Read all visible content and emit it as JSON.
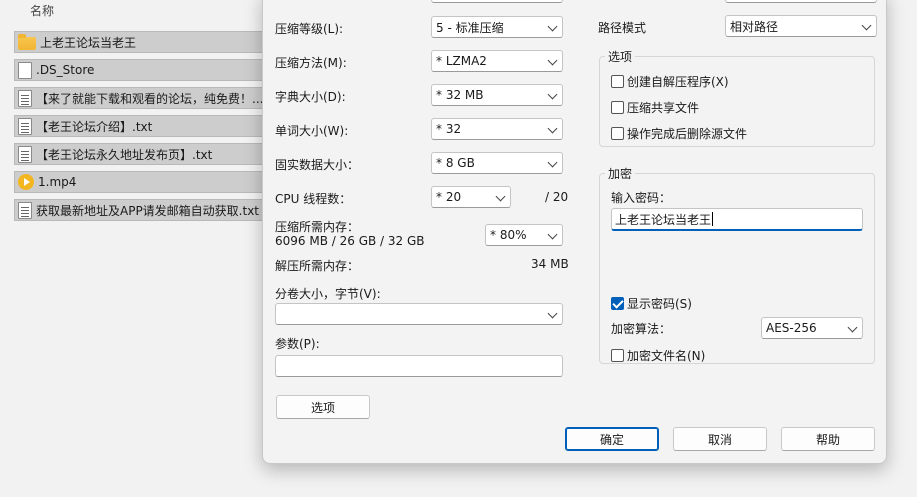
{
  "file_list": {
    "header": "名称",
    "items": [
      {
        "name": "上老王论坛当老王",
        "icon": "folder-icon"
      },
      {
        "name": ".DS_Store",
        "icon": "file-icon"
      },
      {
        "name": "【来了就能下载和观看的论坛，纯免费！...",
        "icon": "text-file-icon"
      },
      {
        "name": "【老王论坛介绍】.txt",
        "icon": "text-file-icon"
      },
      {
        "name": "【老王论坛永久地址发布页】.txt",
        "icon": "text-file-icon"
      },
      {
        "name": "1.mp4",
        "icon": "video-file-icon"
      },
      {
        "name": "获取最新地址及APP请发邮箱自动获取.txt",
        "icon": "text-file-icon"
      }
    ]
  },
  "dialog": {
    "compression_level": {
      "label": "压缩等级(L):",
      "value": "5 - 标准压缩"
    },
    "compression_method": {
      "label": "压缩方法(M):",
      "value": "* LZMA2"
    },
    "dictionary_size": {
      "label": "字典大小(D):",
      "value": "* 32 MB"
    },
    "word_size": {
      "label": "单词大小(W):",
      "value": "* 32"
    },
    "solid_block_size": {
      "label": "固实数据大小：",
      "value": "* 8 GB"
    },
    "cpu_threads": {
      "label": "CPU 线程数：",
      "value": "* 20",
      "max": "/ 20"
    },
    "compress_memory": {
      "label": "压缩所需内存：",
      "detail": "6096 MB / 26 GB / 32 GB",
      "value": "* 80%"
    },
    "decompress_memory": {
      "label": "解压所需内存：",
      "value": "34 MB"
    },
    "split_volumes": {
      "label": "分卷大小，字节(V):",
      "value": ""
    },
    "parameters": {
      "label": "参数(P):",
      "value": ""
    },
    "options_button": "选项",
    "path_mode": {
      "label": "路径模式",
      "value": "相对路径"
    },
    "options_group": {
      "title": "选项",
      "checkboxes": [
        {
          "label": "创建自解压程序(X)",
          "checked": false
        },
        {
          "label": "压缩共享文件",
          "checked": false
        },
        {
          "label": "操作完成后删除源文件",
          "checked": false
        }
      ]
    },
    "encryption_group": {
      "title": "加密",
      "password_label": "输入密码：",
      "password_value": "上老王论坛当老王",
      "show_password": {
        "label": "显示密码(S)",
        "checked": true
      },
      "method_label": "加密算法：",
      "method_value": "AES-256",
      "encrypt_names": {
        "label": "加密文件名(N)",
        "checked": false
      }
    },
    "buttons": {
      "ok": "确定",
      "cancel": "取消",
      "help": "帮助"
    }
  },
  "colors": {
    "accent": "#005fb8",
    "dialog_bg": "#f3f3f3",
    "folder": "#f1b532"
  }
}
